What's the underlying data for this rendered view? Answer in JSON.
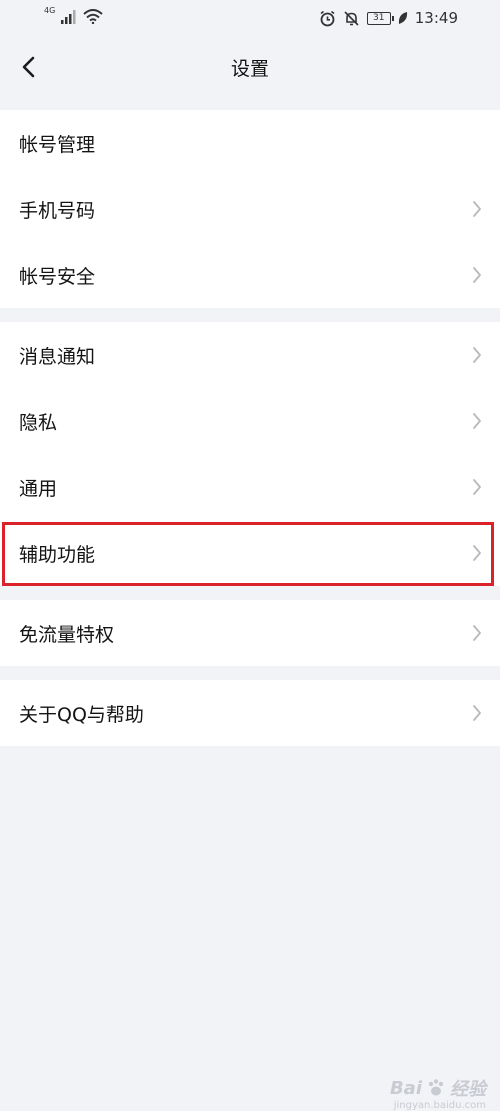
{
  "status_bar": {
    "network": "4G",
    "time": "13:49",
    "battery": "31",
    "icons": [
      "signal-icon",
      "wifi-icon",
      "alarm-icon",
      "mute-bell-icon",
      "battery-icon",
      "leaf-icon"
    ]
  },
  "header": {
    "title": "设置",
    "back_icon": "back-chevron-icon"
  },
  "groups": [
    {
      "items": [
        {
          "label": "帐号管理",
          "chevron": false
        },
        {
          "label": "手机号码",
          "chevron": true
        },
        {
          "label": "帐号安全",
          "chevron": true
        }
      ]
    },
    {
      "items": [
        {
          "label": "消息通知",
          "chevron": true
        },
        {
          "label": "隐私",
          "chevron": true
        },
        {
          "label": "通用",
          "chevron": true
        },
        {
          "label": "辅助功能",
          "chevron": true,
          "highlighted": true
        }
      ]
    },
    {
      "items": [
        {
          "label": "免流量特权",
          "chevron": true
        }
      ]
    },
    {
      "items": [
        {
          "label": "关于QQ与帮助",
          "chevron": true
        }
      ]
    }
  ],
  "colors": {
    "background": "#f2f3f7",
    "row": "#ffffff",
    "highlight": "#d9222a",
    "chevron": "#b8b8bd"
  },
  "watermark": {
    "brand": "Bai",
    "suffix": "经验",
    "url": "jingyan.baidu.com"
  }
}
